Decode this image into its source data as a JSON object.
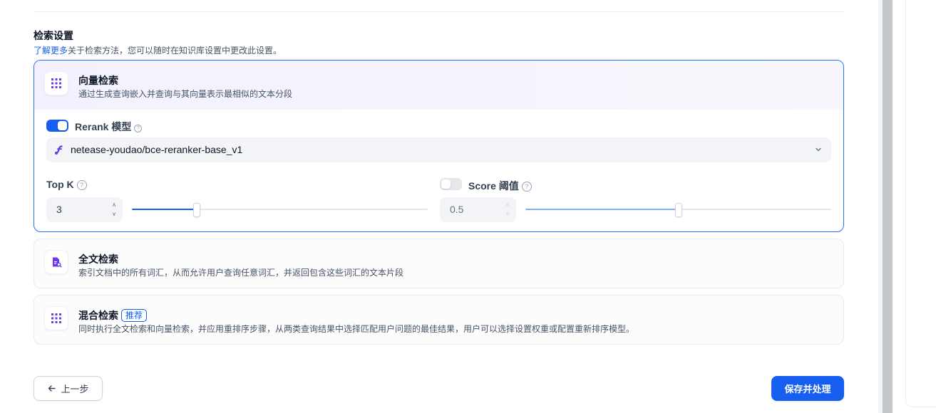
{
  "section": {
    "title": "检索设置",
    "learn_more": "了解更多",
    "subtitle_rest": "关于检索方法，您可以随时在知识库设置中更改此设置。"
  },
  "vector": {
    "title": "向量检索",
    "desc": "通过生成查询嵌入并查询与其向量表示最相似的文本分段",
    "rerank_label": "Rerank 模型",
    "rerank_enabled": true,
    "model_name": "netease-youdao/bce-reranker-base_v1",
    "topk_label": "Top K",
    "topk_value": "3",
    "topk_fraction": 0.22,
    "score_label": "Score 阈值",
    "score_enabled": false,
    "score_value": "0.5",
    "score_fraction": 0.5
  },
  "fulltext": {
    "title": "全文检索",
    "desc": "索引文档中的所有词汇，从而允许用户查询任意词汇，并返回包含这些词汇的文本片段"
  },
  "hybrid": {
    "title": "混合检索",
    "badge": "推荐",
    "desc": "同时执行全文检索和向量检索，并应用重排序步骤，从两类查询结果中选择匹配用户问题的最佳结果，用户可以选择设置权重或配置重新排序模型。"
  },
  "buttons": {
    "back": "上一步",
    "save": "保存并处理"
  },
  "colors": {
    "primary": "#155eef",
    "icon_purple": "#6938ef"
  }
}
